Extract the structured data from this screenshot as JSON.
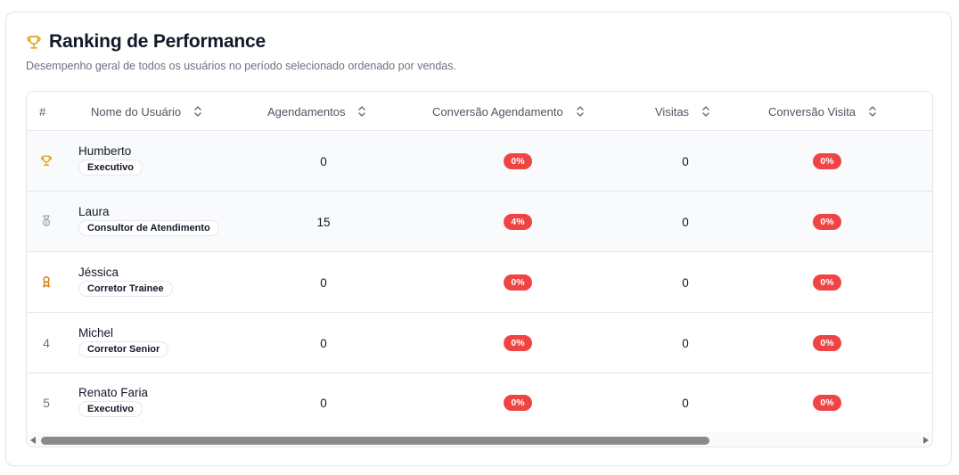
{
  "header": {
    "title": "Ranking de Performance",
    "subtitle": "Desempenho geral de todos os usuários no período selecionado ordenado por vendas.",
    "icon": "trophy-icon"
  },
  "table": {
    "columns": {
      "rank": "#",
      "name": "Nome do Usuário",
      "appointments": "Agendamentos",
      "appointment_conversion": "Conversão Agendamento",
      "visits": "Visitas",
      "visit_conversion": "Conversão Visita"
    },
    "rows": [
      {
        "rank": "",
        "rank_icon": "trophy-icon",
        "name": "Humberto",
        "role": "Executivo",
        "appointments": "0",
        "appointment_conversion": "0%",
        "visits": "0",
        "visit_conversion": "0%"
      },
      {
        "rank": "",
        "rank_icon": "medal-icon",
        "name": "Laura",
        "role": "Consultor de Atendimento",
        "appointments": "15",
        "appointment_conversion": "4%",
        "visits": "0",
        "visit_conversion": "0%"
      },
      {
        "rank": "",
        "rank_icon": "award-icon",
        "name": "Jéssica",
        "role": "Corretor Trainee",
        "appointments": "0",
        "appointment_conversion": "0%",
        "visits": "0",
        "visit_conversion": "0%"
      },
      {
        "rank": "4",
        "rank_icon": "",
        "name": "Michel",
        "role": "Corretor Senior",
        "appointments": "0",
        "appointment_conversion": "0%",
        "visits": "0",
        "visit_conversion": "0%"
      },
      {
        "rank": "5",
        "rank_icon": "",
        "name": "Renato Faria",
        "role": "Executivo",
        "appointments": "0",
        "appointment_conversion": "0%",
        "visits": "0",
        "visit_conversion": "0%"
      }
    ]
  },
  "colors": {
    "gold": "#e0a91b",
    "silver": "#9ca3af",
    "bronze": "#d97706",
    "badge_red": "#ef4444"
  }
}
